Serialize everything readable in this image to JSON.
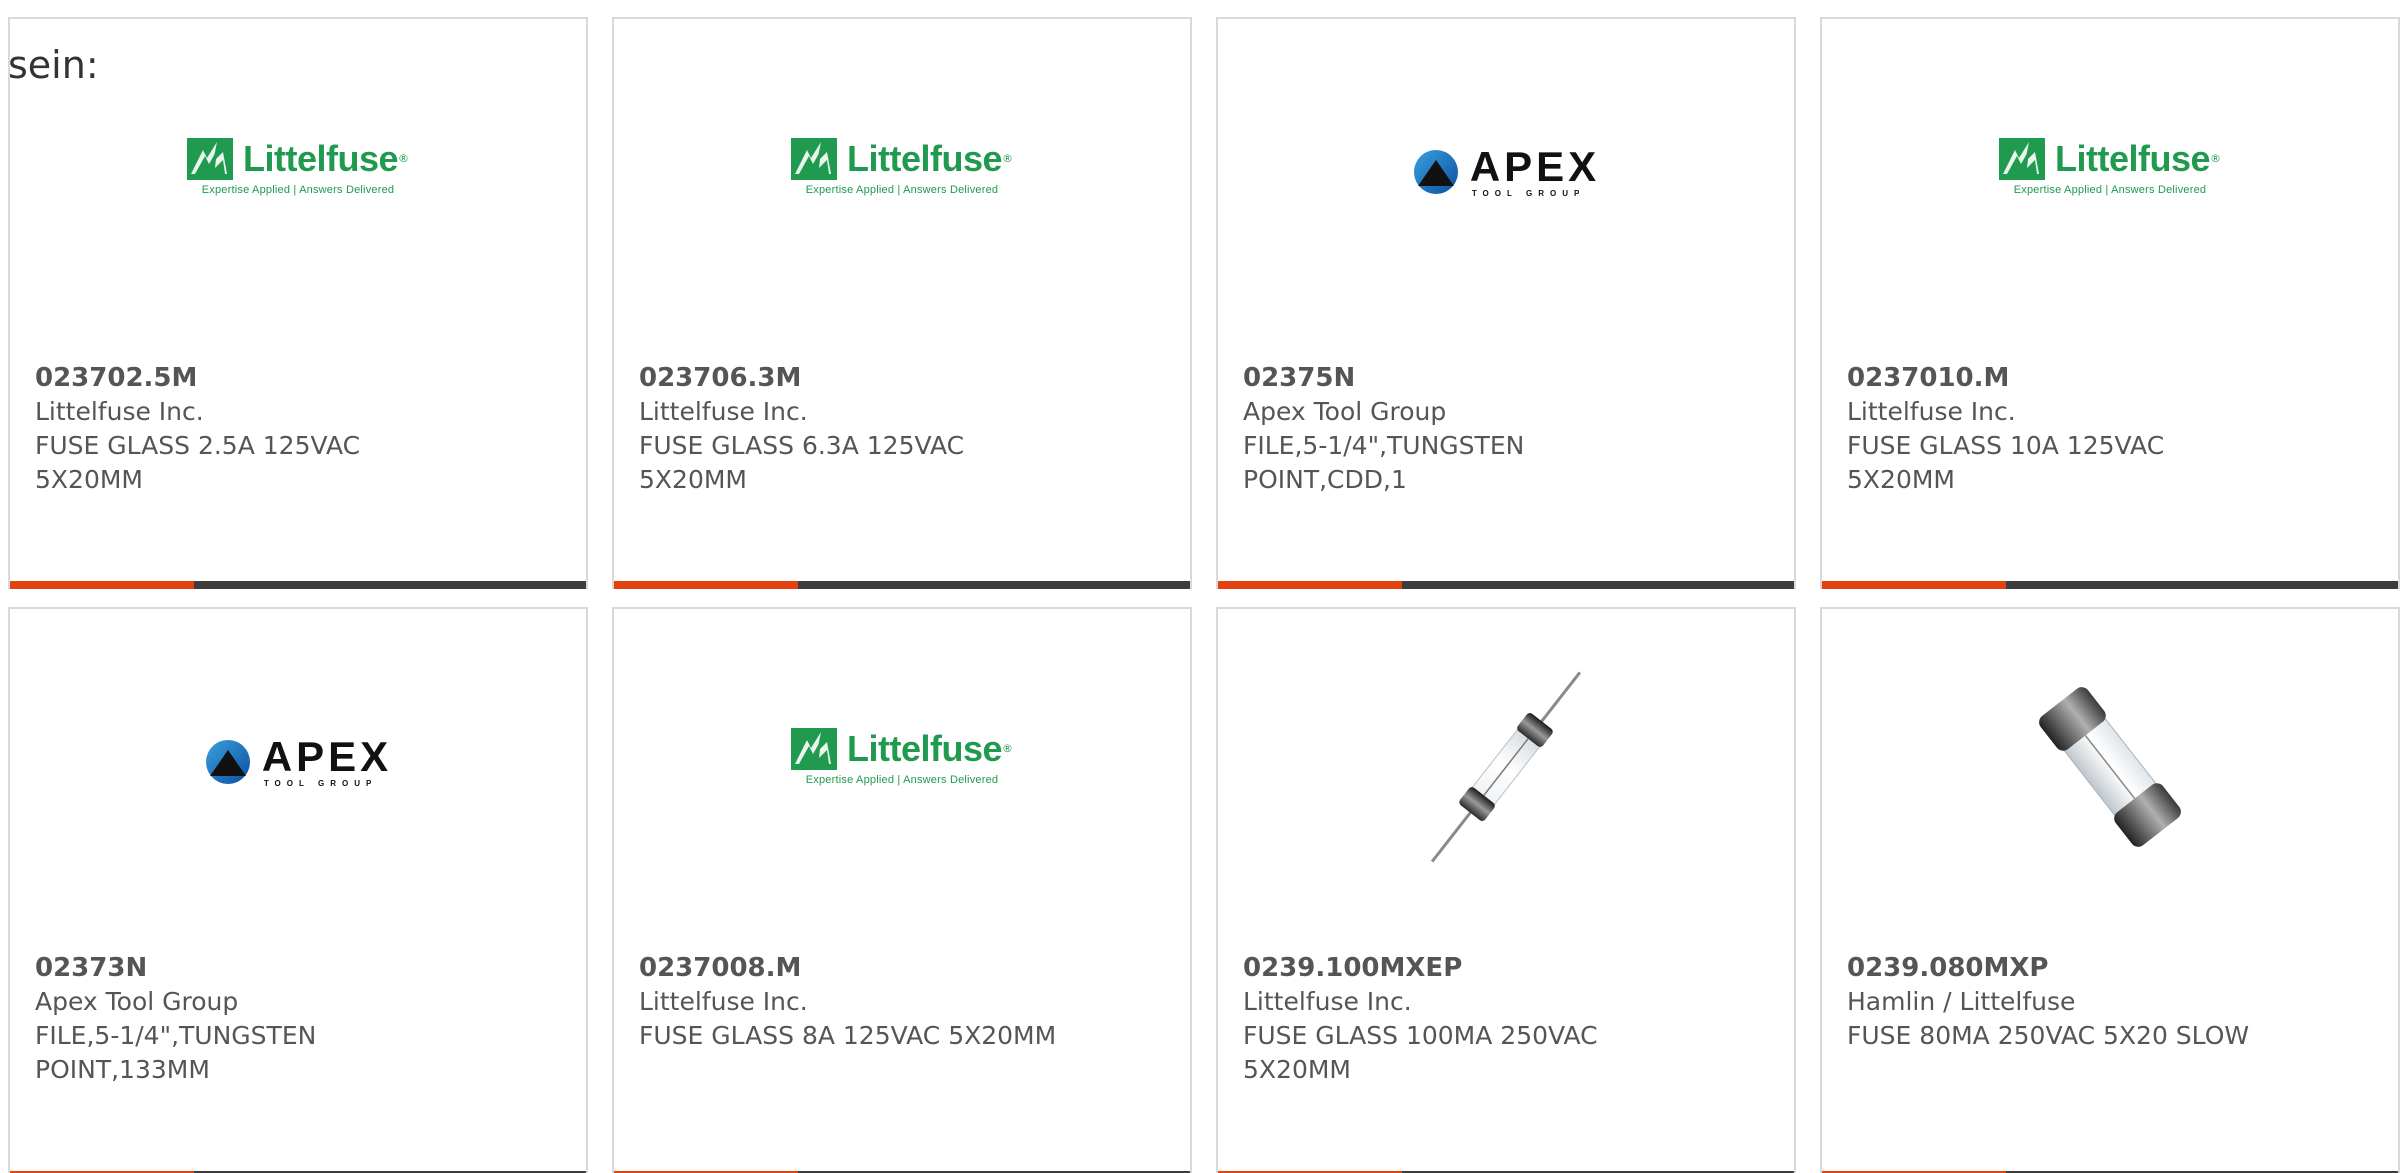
{
  "intro": "sein:",
  "logos": {
    "littelfuse": {
      "name": "Littelfuse",
      "reg": "®",
      "tagline": "Expertise Applied | Answers Delivered",
      "color": "#1f9a4e"
    },
    "apex": {
      "name": "APEX",
      "sub": "TOOL GROUP",
      "color": "#111111"
    }
  },
  "accent_colors": {
    "bar_accent": "#e2420d",
    "bar_base": "#3d3d3d"
  },
  "products": [
    {
      "part": "023702.5M",
      "maker": "Littelfuse Inc.",
      "desc1": "FUSE GLASS 2.5A 125VAC",
      "desc2": "5X20MM",
      "image": "littelfuse-logo"
    },
    {
      "part": "023706.3M",
      "maker": "Littelfuse Inc.",
      "desc1": "FUSE GLASS 6.3A 125VAC",
      "desc2": "5X20MM",
      "image": "littelfuse-logo"
    },
    {
      "part": "02375N",
      "maker": "Apex Tool Group",
      "desc1": "FILE,5-1/4\",TUNGSTEN",
      "desc2": "POINT,CDD,1",
      "image": "apex-logo"
    },
    {
      "part": "0237010.M",
      "maker": "Littelfuse Inc.",
      "desc1": "FUSE GLASS 10A 125VAC",
      "desc2": "5X20MM",
      "image": "littelfuse-logo"
    },
    {
      "part": "02373N",
      "maker": "Apex Tool Group",
      "desc1": "FILE,5-1/4\",TUNGSTEN",
      "desc2": "POINT,133MM",
      "image": "apex-logo"
    },
    {
      "part": "0237008.M",
      "maker": "Littelfuse Inc.",
      "desc1": "FUSE GLASS 8A 125VAC 5X20MM",
      "desc2": "",
      "image": "littelfuse-logo"
    },
    {
      "part": "0239.100MXEP",
      "maker": "Littelfuse Inc.",
      "desc1": "FUSE GLASS 100MA 250VAC",
      "desc2": "5X20MM",
      "image": "fuse-axial-photo"
    },
    {
      "part": "0239.080MXP",
      "maker": "Hamlin / Littelfuse",
      "desc1": "FUSE 80MA 250VAC 5X20 SLOW",
      "desc2": "",
      "image": "fuse-cartridge-photo"
    }
  ]
}
